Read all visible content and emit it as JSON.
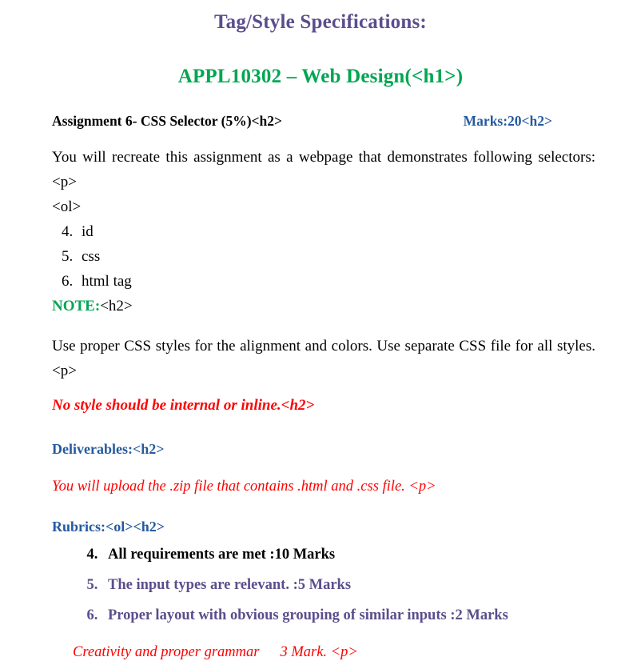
{
  "document": {
    "title": "Tag/Style Specifications:",
    "course_heading": "APPL10302 – Web Design(<h1>)",
    "assignment": {
      "label": "Assignment 6- CSS Selector (5%)<h2>",
      "marks": "Marks:20<h2>"
    },
    "intro": {
      "paragraph": "You will recreate this assignment as a webpage that demonstrates following selectors:<p>",
      "ol_tag": "<ol>"
    },
    "selector_list": [
      "id",
      "css",
      "html tag"
    ],
    "selector_list_start": 4,
    "note": {
      "label": "NOTE:",
      "tag": "<h2>",
      "body": "Use proper CSS styles for the alignment and colors. Use separate CSS file for all styles. <p>",
      "warning": "No style should be internal or inline.<h2>"
    },
    "deliverables": {
      "heading": "Deliverables:<h2>",
      "text": "You will upload the .zip file that contains .html and .css file. <p>"
    },
    "rubrics": {
      "heading": "Rubrics:<ol><h2>",
      "list_start": 4,
      "items": [
        {
          "text": "All requirements are met :10 Marks",
          "color": "black"
        },
        {
          "text": "The input types are relevant. :5 Marks",
          "color": "purple"
        },
        {
          "text": "Proper layout with obvious grouping of similar inputs :2 Marks",
          "color": "purple"
        }
      ],
      "closing_text": "Creativity and proper grammar",
      "closing_marks": "3 Mark. <p>"
    },
    "colors": {
      "purple": "#5B4E8C",
      "green": "#00A651",
      "blue": "#255A9E",
      "red": "#FF0000",
      "black": "#000000"
    }
  }
}
